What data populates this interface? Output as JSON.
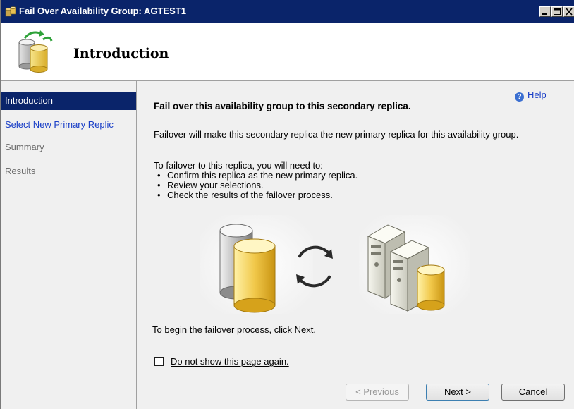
{
  "window": {
    "title": "Fail Over Availability Group: AGTEST1",
    "icon": "database-icon"
  },
  "titlebar_buttons": [
    "minimize-icon",
    "maximize-icon",
    "close-icon"
  ],
  "header": {
    "title": "Introduction",
    "icon": "database-failover-icon"
  },
  "sidebar": {
    "items": [
      {
        "label": "Introduction",
        "state": "selected"
      },
      {
        "label": "Select New Primary Replic",
        "state": "link"
      },
      {
        "label": "Summary",
        "state": "disabled"
      },
      {
        "label": "Results",
        "state": "disabled"
      }
    ]
  },
  "content": {
    "help_label": "Help",
    "heading": "Fail over this availability group to this secondary replica.",
    "description": "Failover will make this secondary replica the new primary replica for this availability group.",
    "intro": "To failover to this replica, you will need to:",
    "bullets": [
      "Confirm this replica as the new primary replica.",
      "Review your selections.",
      "Check the results of the failover process."
    ],
    "begin": "To begin the failover process, click Next.",
    "checkbox_label": "Do not show this page again.",
    "checkbox_checked": false
  },
  "footer": {
    "previous_label": "< Previous",
    "next_label": "Next >",
    "cancel_label": "Cancel"
  },
  "colors": {
    "titlebar": "#0a246a",
    "selected_bg": "#0a246a",
    "link": "#1a3fc7",
    "disabled_text": "#6d6d6d"
  }
}
